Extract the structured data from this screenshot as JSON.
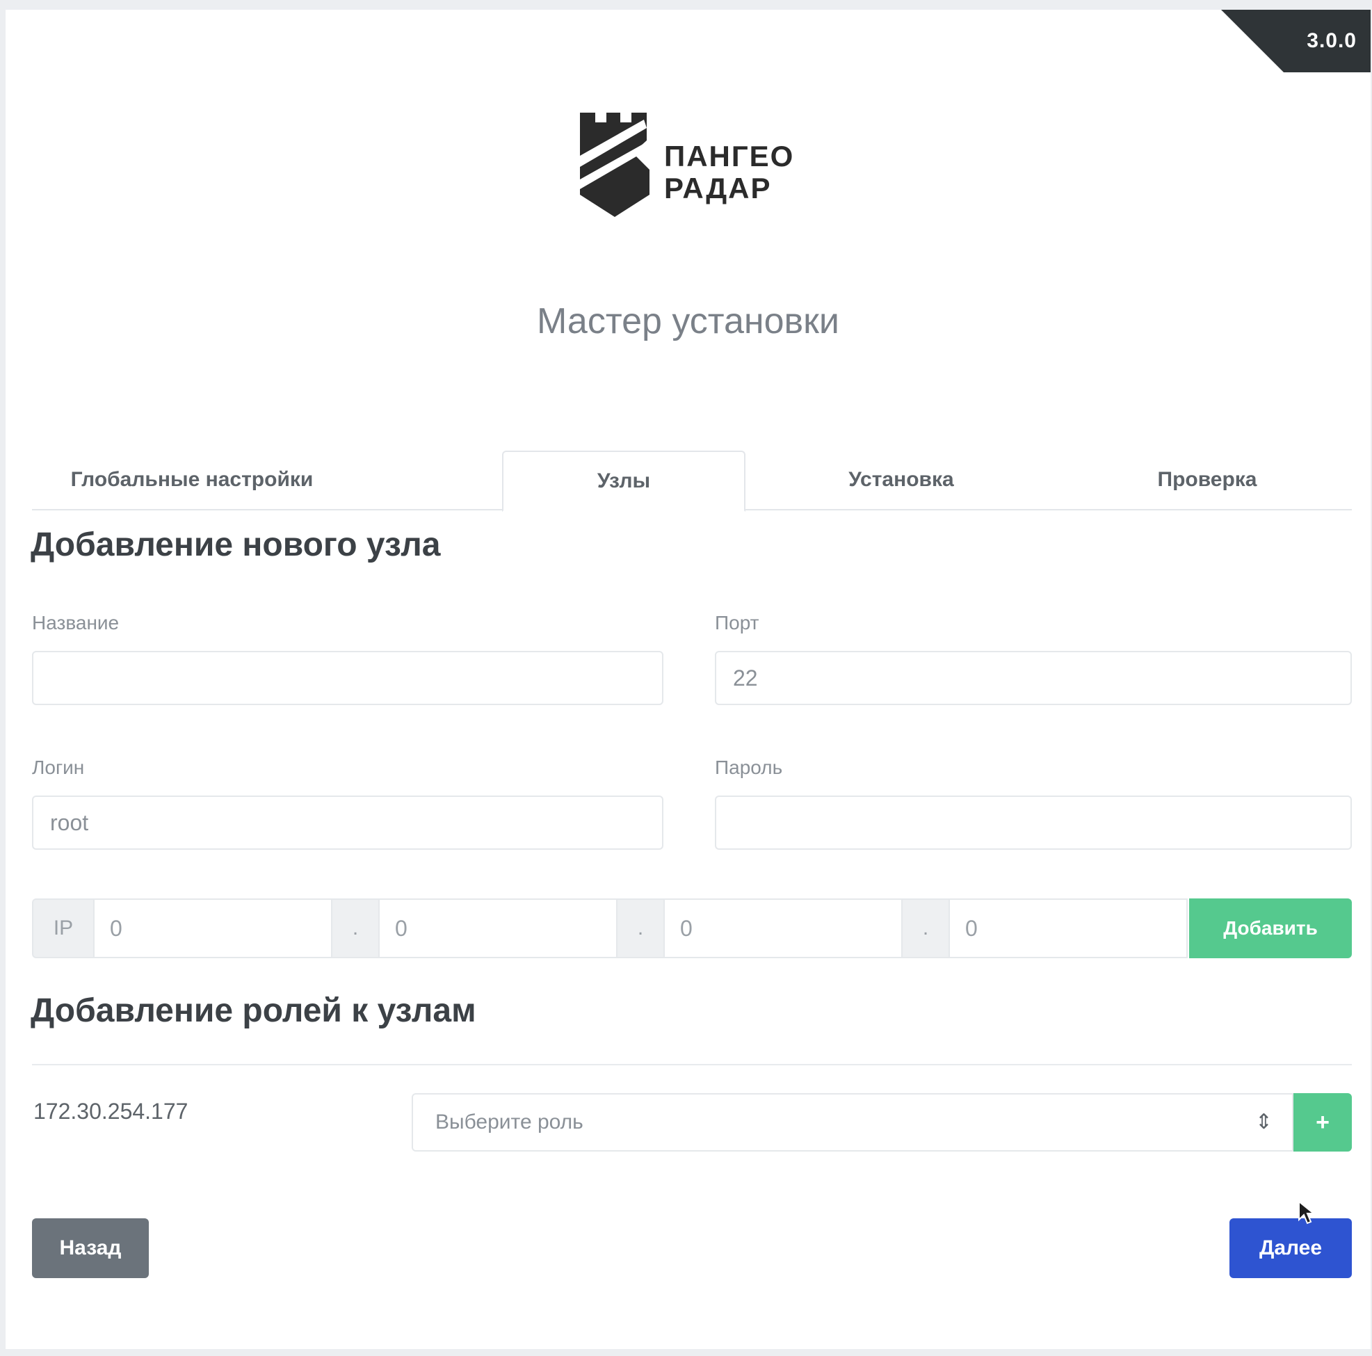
{
  "version": "3.0.0",
  "brand": {
    "line1": "ПАНГЕО",
    "line2": "РАДАР"
  },
  "wizard_title": "Мастер установки",
  "tabs": [
    {
      "label": "Глобальные настройки",
      "active": false
    },
    {
      "label": "Узлы",
      "active": true
    },
    {
      "label": "Установка",
      "active": false
    },
    {
      "label": "Проверка",
      "active": false
    }
  ],
  "add_node": {
    "title": "Добавление нового узла",
    "name_label": "Название",
    "name_value": "",
    "port_label": "Порт",
    "port_value": "22",
    "login_label": "Логин",
    "login_value": "root",
    "password_label": "Пароль",
    "password_value": "",
    "ip_prefix": "IP",
    "ip_separator": ".",
    "ip_octets": [
      "0",
      "0",
      "0",
      "0"
    ],
    "add_button": "Добавить"
  },
  "roles": {
    "title": "Добавление ролей к узлам",
    "node_ip": "172.30.254.177",
    "select_placeholder": "Выберите роль",
    "select_arrows": "⇕",
    "add_role_button": "+"
  },
  "footer": {
    "back_button": "Назад",
    "next_button": "Далее"
  },
  "colors": {
    "green": "#55c98e",
    "blue": "#2e54d1",
    "gray": "#6b737b",
    "ribbon": "#2f3437"
  }
}
